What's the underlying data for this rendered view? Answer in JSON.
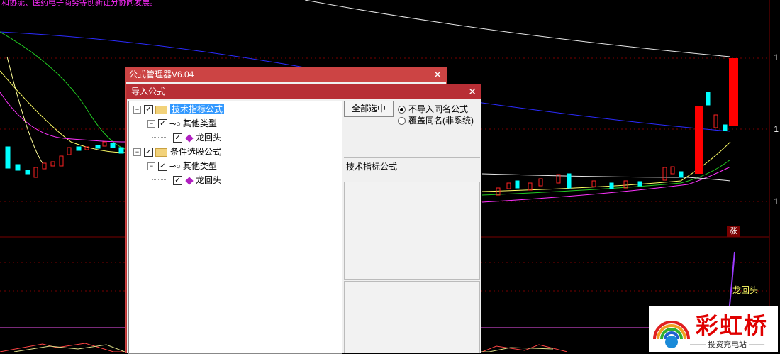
{
  "background": {
    "news_ticker": "和协流、医药电子商务等创新让分协同发展。",
    "price_labels": [
      "1",
      "1",
      "1"
    ],
    "zhang_badge": "涨",
    "indicator_name": "龙回头",
    "colors": {
      "up": "#ff0000",
      "down": "#00ffff",
      "ma_blue": "#2222ff",
      "ma_white": "#e6e6e6",
      "ma_green": "#22cc22",
      "ma_yellow": "#ffff66",
      "ma_magenta": "#ff33ff"
    }
  },
  "watermark": {
    "brand": "彩虹桥",
    "slogan": "—— 投资充电站 ——",
    "icon": "rainbow-logo-icon"
  },
  "outer_window": {
    "title": "公式管理器V6.04",
    "close": "✕"
  },
  "import_dialog": {
    "title": "导入公式",
    "close": "✕",
    "tree": {
      "group1": {
        "label": "技术指标公式",
        "sub": {
          "label": "其他类型",
          "leaf": "龙回头"
        }
      },
      "group2": {
        "label": "条件选股公式",
        "sub": {
          "label": "其他类型",
          "leaf": "龙回头"
        }
      }
    },
    "select_all_button": "全部选中",
    "options": [
      {
        "label": "不导入同名公式",
        "checked": true
      },
      {
        "label": "覆盖同名(非系统)",
        "checked": false
      }
    ],
    "formula_type_label": "技术指标公式"
  }
}
